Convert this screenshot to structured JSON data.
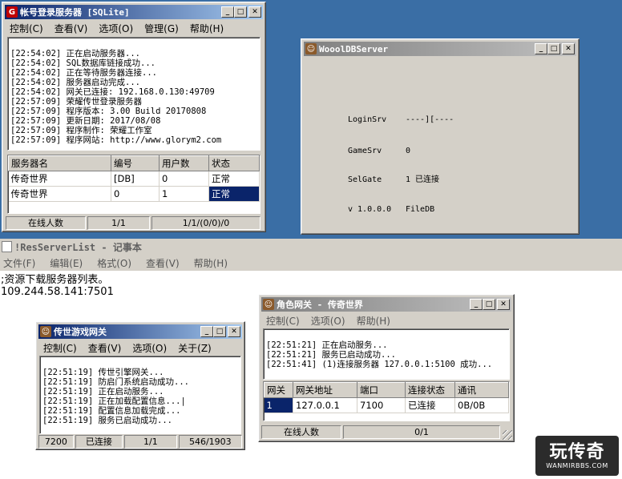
{
  "account_server": {
    "title": "帐号登录服务器 [SQLite]",
    "icon_letter": "G",
    "menu": [
      "控制(C)",
      "查看(V)",
      "选项(O)",
      "管理(G)",
      "帮助(H)"
    ],
    "log": [
      "[22:54:02] 正在启动服务器...",
      "[22:54:02] SQL数据库链接成功...",
      "[22:54:02] 正在等待服务器连接...",
      "[22:54:02] 服务器启动完成...",
      "[22:54:02] 网关已连接: 192.168.0.130:49709",
      "[22:57:09] 荣耀传世登录服务器",
      "[22:57:09] 程序版本: 3.00 Build 20170808",
      "[22:57:09] 更新日期: 2017/08/08",
      "[22:57:09] 程序制作: 荣耀工作室",
      "[22:57:09] 程序网站: http://www.glorym2.com"
    ],
    "columns": [
      "服务器名",
      "编号",
      "用户数",
      "状态"
    ],
    "rows": [
      [
        "传奇世界",
        "[DB]",
        "0",
        "正常"
      ],
      [
        "传奇世界",
        "0",
        "1",
        "正常"
      ]
    ],
    "status": [
      "在线人数",
      "1/1",
      "1/1/(0/0)/0"
    ]
  },
  "db_server": {
    "title": "WooolDBServer",
    "rows": [
      {
        "label": "LoginSrv",
        "value": "----][----"
      },
      {
        "label": "GameSrv",
        "value": "0"
      },
      {
        "label": "SelGate",
        "value": "1 已连接"
      },
      {
        "label": "v 1.0.0.0",
        "value": "FileDB"
      }
    ]
  },
  "notepad": {
    "title": "!ResServerList - 记事本",
    "menu": [
      "文件(F)",
      "编辑(E)",
      "格式(O)",
      "查看(V)",
      "帮助(H)"
    ],
    "lines": [
      ";资源下载服务器列表。",
      "109.244.58.141:7501"
    ]
  },
  "game_gate": {
    "title": "传世游戏网关",
    "menu": [
      "控制(C)",
      "查看(V)",
      "选项(O)",
      "关于(Z)"
    ],
    "log": [
      "[22:51:19] 传世引擎网关...",
      "[22:51:19] 防启门系统启动成功...",
      "[22:51:19] 正在启动服务...",
      "[22:51:19] 正在加载配置信息...|",
      "[22:51:19] 配置信息加载完成...",
      "[22:51:19] 服务已启动成功..."
    ],
    "status": [
      "7200",
      "已连接",
      "1/1",
      "546/1903"
    ]
  },
  "role_gate": {
    "title": "角色网关 - 传奇世界",
    "menu": [
      "控制(C)",
      "选项(O)",
      "帮助(H)"
    ],
    "log": [
      "[22:51:21] 正在启动服务...",
      "[22:51:21] 服务已启动成功...",
      "[22:51:41] (1)连接服务器 127.0.0.1:5100 成功..."
    ],
    "columns": [
      "网关",
      "网关地址",
      "端口",
      "连接状态",
      "通讯"
    ],
    "rows": [
      [
        "1",
        "127.0.0.1",
        "7100",
        "已连接",
        "0B/0B"
      ]
    ],
    "status": [
      "在线人数",
      "0/1"
    ]
  },
  "watermark": {
    "main": "玩传奇",
    "sub": "WANMIRBBS.COM"
  },
  "colors": {
    "desktop": "#3a6ea5",
    "face": "#d4d0c8",
    "active_title": "#0a246a",
    "selection": "#0a246a",
    "logo_bg": "#2b2b2b"
  },
  "icons": {
    "window_controls": [
      "minimize-icon",
      "maximize-icon",
      "close-icon"
    ]
  }
}
